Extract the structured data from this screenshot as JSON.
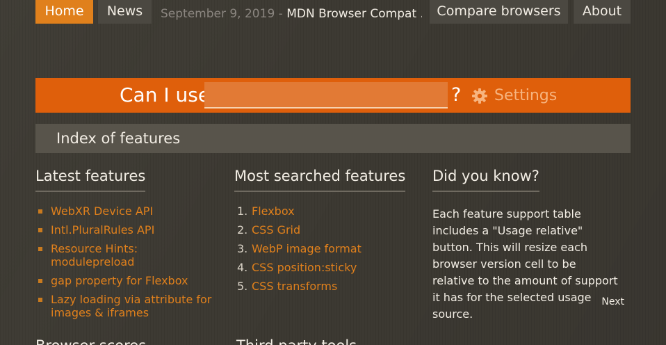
{
  "nav": {
    "home": "Home",
    "news": "News",
    "compare": "Compare browsers",
    "about": "About"
  },
  "news_ticker": {
    "date": "September 9, 2019 - ",
    "title": "MDN Browser Compat ..."
  },
  "search": {
    "prefix": "Can I use",
    "value": "",
    "placeholder": "",
    "question_mark": "?",
    "settings_label": "Settings",
    "settings_icon": "gear-icon"
  },
  "index": {
    "title": "Index of features"
  },
  "latest": {
    "heading": "Latest features",
    "items": [
      "WebXR Device API",
      "Intl.PluralRules API",
      "Resource Hints: modulepreload",
      "gap property for Flexbox",
      "Lazy loading via attribute for images & iframes"
    ]
  },
  "most_searched": {
    "heading": "Most searched features",
    "items": [
      {
        "num": "1.",
        "label": "Flexbox"
      },
      {
        "num": "2.",
        "label": "CSS Grid"
      },
      {
        "num": "3.",
        "label": "WebP image format"
      },
      {
        "num": "4.",
        "label": "CSS position:sticky"
      },
      {
        "num": "5.",
        "label": "CSS transforms"
      }
    ]
  },
  "did_you_know": {
    "heading": "Did you know?",
    "text": "Each feature support table includes a \"Usage relative\" button. This will resize each browser version cell to be relative to the amount of support it has for the selected usage source.",
    "next": "Next"
  },
  "bottom": {
    "browser_scores": "Browser scores",
    "third_party": "Third party tools"
  },
  "colors": {
    "accent_orange": "#e0801c",
    "banner_orange": "#df5f0b",
    "background": "#3d3a33"
  }
}
